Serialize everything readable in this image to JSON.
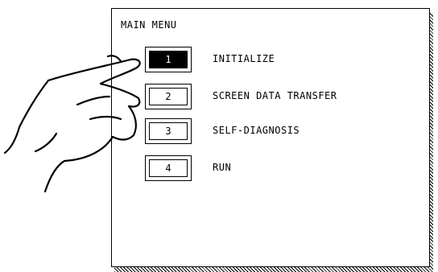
{
  "menu": {
    "title": "MAIN MENU",
    "items": [
      {
        "key": "1",
        "label": "INITIALIZE",
        "active": true
      },
      {
        "key": "2",
        "label": "SCREEN DATA TRANSFER",
        "active": false
      },
      {
        "key": "3",
        "label": "SELF-DIAGNOSIS",
        "active": false
      },
      {
        "key": "4",
        "label": "RUN",
        "active": false
      }
    ]
  },
  "hand_icon": "pointing-hand-icon",
  "colors": {
    "foreground": "#000000",
    "background": "#ffffff"
  }
}
